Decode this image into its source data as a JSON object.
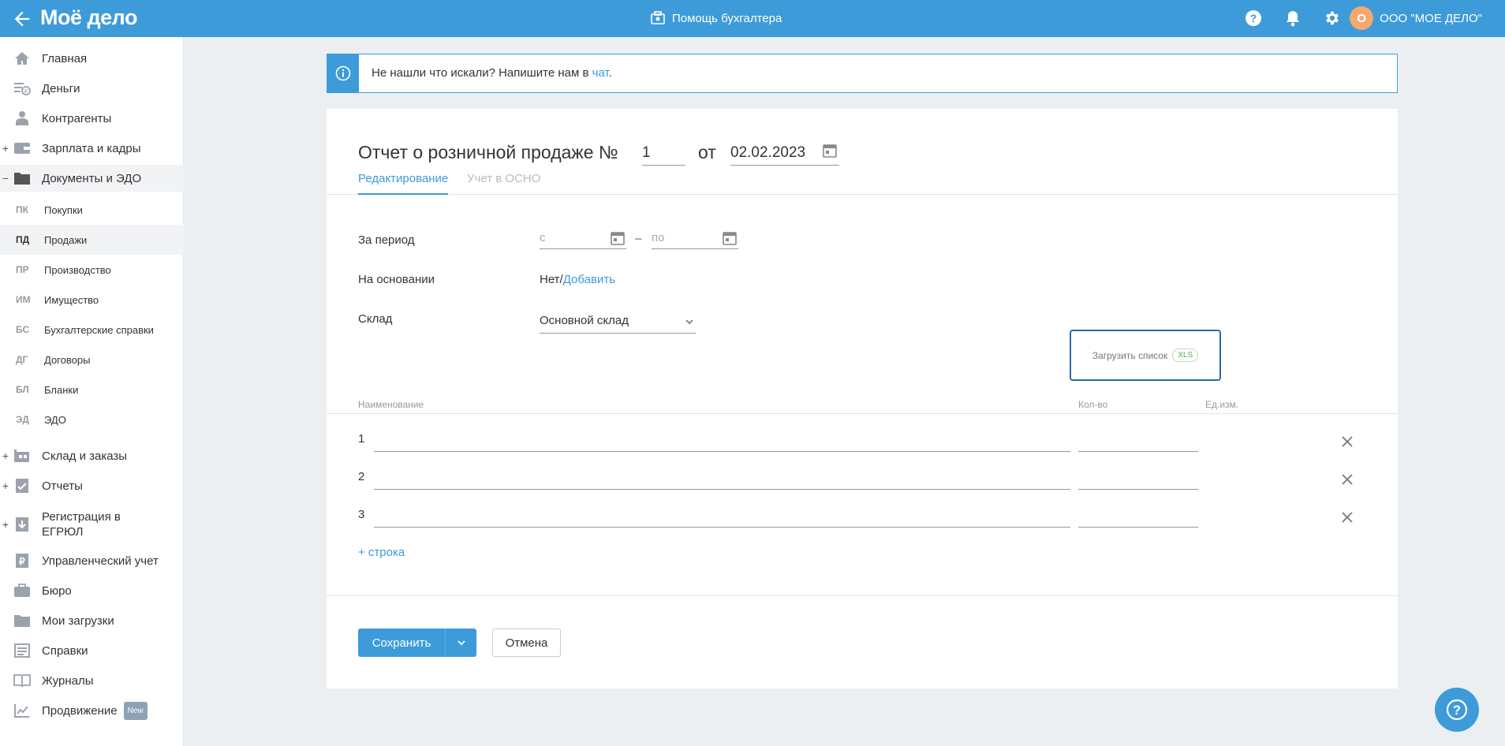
{
  "header": {
    "logo": "Моё дело",
    "helper": "Помощь бухгалтера",
    "org_initial": "О",
    "org_name": "ООО \"МОЕ ДЕЛО\""
  },
  "sidebar": {
    "items": [
      {
        "label": "Главная",
        "icon": "home-icon"
      },
      {
        "label": "Деньги",
        "icon": "money-icon"
      },
      {
        "label": "Контрагенты",
        "icon": "contractors-icon"
      },
      {
        "label": "Зарплата и кадры",
        "icon": "wallet-icon",
        "expand": "+"
      },
      {
        "label": "Документы и ЭДО",
        "icon": "folder-icon",
        "expand": "−"
      }
    ],
    "subitems": [
      {
        "abbr": "ПК",
        "label": "Покупки"
      },
      {
        "abbr": "ПД",
        "label": "Продажи"
      },
      {
        "abbr": "ПР",
        "label": "Производство"
      },
      {
        "abbr": "ИМ",
        "label": "Имущество"
      },
      {
        "abbr": "БС",
        "label": "Бухгалтерские справки"
      },
      {
        "abbr": "ДГ",
        "label": "Договоры"
      },
      {
        "abbr": "БЛ",
        "label": "Бланки"
      },
      {
        "abbr": "ЭД",
        "label": "ЭДО"
      }
    ],
    "items2": [
      {
        "label": "Склад и заказы",
        "icon": "warehouse-icon",
        "expand": "+"
      },
      {
        "label": "Отчеты",
        "icon": "reports-icon",
        "expand": "+"
      },
      {
        "label": "Регистрация в ЕГРЮЛ",
        "icon": "registration-icon",
        "expand": "+"
      },
      {
        "label": "Управленческий учет",
        "icon": "management-icon"
      },
      {
        "label": "Бюро",
        "icon": "briefcase-icon"
      },
      {
        "label": "Мои загрузки",
        "icon": "folder-icon"
      },
      {
        "label": "Справки",
        "icon": "references-icon"
      },
      {
        "label": "Журналы",
        "icon": "journals-icon"
      },
      {
        "label": "Продвижение",
        "icon": "promotion-icon",
        "badge": "New"
      }
    ]
  },
  "info": {
    "text": "Не нашли что искали? Напишите нам в ",
    "link": "чат",
    "end": "."
  },
  "form": {
    "title": "Отчет о розничной продаже №",
    "number": "1",
    "from": "от",
    "date": "02.02.2023",
    "tabs": [
      "Редактирование",
      "Учет в ОСНО"
    ],
    "period_label": "За период",
    "period_from_placeholder": "с",
    "period_to_placeholder": "по",
    "period_dash": "–",
    "basis_label": "На основании",
    "basis_value": "Нет/",
    "basis_link": "Добавить",
    "warehouse_label": "Склад",
    "warehouse_value": "Основной склад",
    "upload_label": "Загрузить список",
    "upload_badge": "XLS",
    "columns": {
      "name": "Наименование",
      "qty": "Кол-во",
      "unit": "Ед.изм."
    },
    "rows": [
      "1",
      "2",
      "3"
    ],
    "add_row": "+ строка",
    "save": "Сохранить",
    "cancel": "Отмена"
  },
  "colors": {
    "accent": "#3e9bd9",
    "upload_border": "#2d68b0"
  }
}
